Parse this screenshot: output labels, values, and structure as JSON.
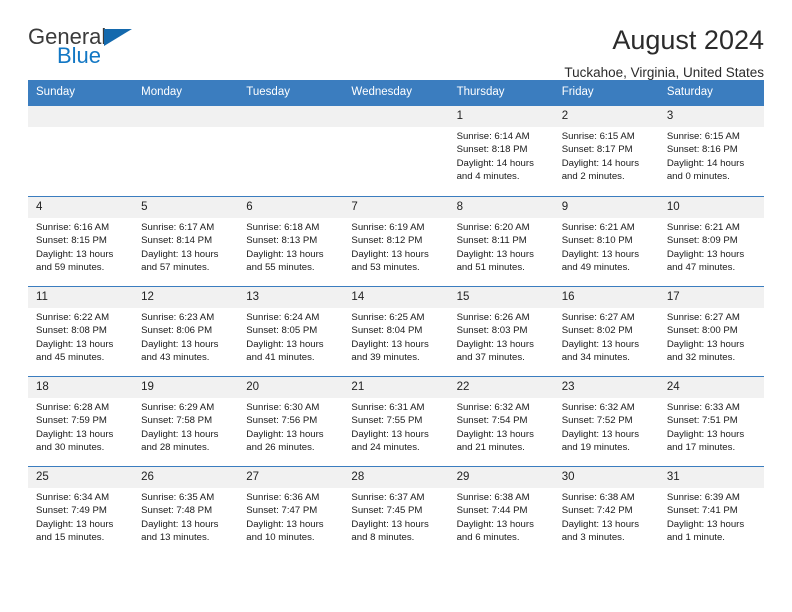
{
  "logo": {
    "line1": "General",
    "line2": "Blue",
    "triangle_icon": "triangle-icon",
    "color_text": "#3b3b3b",
    "color_accent": "#1277c4"
  },
  "header": {
    "title": "August 2024",
    "subtitle": "Tuckahoe, Virginia, United States"
  },
  "theme": {
    "header_blue": "#3b7dbf",
    "daynum_gray": "#f1f1f1"
  },
  "weekdays": [
    "Sunday",
    "Monday",
    "Tuesday",
    "Wednesday",
    "Thursday",
    "Friday",
    "Saturday"
  ],
  "weeks": [
    [
      {
        "day": "",
        "sunrise": "",
        "sunset": "",
        "daylight1": "",
        "daylight2": "",
        "empty": true
      },
      {
        "day": "",
        "sunrise": "",
        "sunset": "",
        "daylight1": "",
        "daylight2": "",
        "empty": true
      },
      {
        "day": "",
        "sunrise": "",
        "sunset": "",
        "daylight1": "",
        "daylight2": "",
        "empty": true
      },
      {
        "day": "",
        "sunrise": "",
        "sunset": "",
        "daylight1": "",
        "daylight2": "",
        "empty": true
      },
      {
        "day": "1",
        "sunrise": "Sunrise: 6:14 AM",
        "sunset": "Sunset: 8:18 PM",
        "daylight1": "Daylight: 14 hours",
        "daylight2": "and 4 minutes."
      },
      {
        "day": "2",
        "sunrise": "Sunrise: 6:15 AM",
        "sunset": "Sunset: 8:17 PM",
        "daylight1": "Daylight: 14 hours",
        "daylight2": "and 2 minutes."
      },
      {
        "day": "3",
        "sunrise": "Sunrise: 6:15 AM",
        "sunset": "Sunset: 8:16 PM",
        "daylight1": "Daylight: 14 hours",
        "daylight2": "and 0 minutes."
      }
    ],
    [
      {
        "day": "4",
        "sunrise": "Sunrise: 6:16 AM",
        "sunset": "Sunset: 8:15 PM",
        "daylight1": "Daylight: 13 hours",
        "daylight2": "and 59 minutes."
      },
      {
        "day": "5",
        "sunrise": "Sunrise: 6:17 AM",
        "sunset": "Sunset: 8:14 PM",
        "daylight1": "Daylight: 13 hours",
        "daylight2": "and 57 minutes."
      },
      {
        "day": "6",
        "sunrise": "Sunrise: 6:18 AM",
        "sunset": "Sunset: 8:13 PM",
        "daylight1": "Daylight: 13 hours",
        "daylight2": "and 55 minutes."
      },
      {
        "day": "7",
        "sunrise": "Sunrise: 6:19 AM",
        "sunset": "Sunset: 8:12 PM",
        "daylight1": "Daylight: 13 hours",
        "daylight2": "and 53 minutes."
      },
      {
        "day": "8",
        "sunrise": "Sunrise: 6:20 AM",
        "sunset": "Sunset: 8:11 PM",
        "daylight1": "Daylight: 13 hours",
        "daylight2": "and 51 minutes."
      },
      {
        "day": "9",
        "sunrise": "Sunrise: 6:21 AM",
        "sunset": "Sunset: 8:10 PM",
        "daylight1": "Daylight: 13 hours",
        "daylight2": "and 49 minutes."
      },
      {
        "day": "10",
        "sunrise": "Sunrise: 6:21 AM",
        "sunset": "Sunset: 8:09 PM",
        "daylight1": "Daylight: 13 hours",
        "daylight2": "and 47 minutes."
      }
    ],
    [
      {
        "day": "11",
        "sunrise": "Sunrise: 6:22 AM",
        "sunset": "Sunset: 8:08 PM",
        "daylight1": "Daylight: 13 hours",
        "daylight2": "and 45 minutes."
      },
      {
        "day": "12",
        "sunrise": "Sunrise: 6:23 AM",
        "sunset": "Sunset: 8:06 PM",
        "daylight1": "Daylight: 13 hours",
        "daylight2": "and 43 minutes."
      },
      {
        "day": "13",
        "sunrise": "Sunrise: 6:24 AM",
        "sunset": "Sunset: 8:05 PM",
        "daylight1": "Daylight: 13 hours",
        "daylight2": "and 41 minutes."
      },
      {
        "day": "14",
        "sunrise": "Sunrise: 6:25 AM",
        "sunset": "Sunset: 8:04 PM",
        "daylight1": "Daylight: 13 hours",
        "daylight2": "and 39 minutes."
      },
      {
        "day": "15",
        "sunrise": "Sunrise: 6:26 AM",
        "sunset": "Sunset: 8:03 PM",
        "daylight1": "Daylight: 13 hours",
        "daylight2": "and 37 minutes."
      },
      {
        "day": "16",
        "sunrise": "Sunrise: 6:27 AM",
        "sunset": "Sunset: 8:02 PM",
        "daylight1": "Daylight: 13 hours",
        "daylight2": "and 34 minutes."
      },
      {
        "day": "17",
        "sunrise": "Sunrise: 6:27 AM",
        "sunset": "Sunset: 8:00 PM",
        "daylight1": "Daylight: 13 hours",
        "daylight2": "and 32 minutes."
      }
    ],
    [
      {
        "day": "18",
        "sunrise": "Sunrise: 6:28 AM",
        "sunset": "Sunset: 7:59 PM",
        "daylight1": "Daylight: 13 hours",
        "daylight2": "and 30 minutes."
      },
      {
        "day": "19",
        "sunrise": "Sunrise: 6:29 AM",
        "sunset": "Sunset: 7:58 PM",
        "daylight1": "Daylight: 13 hours",
        "daylight2": "and 28 minutes."
      },
      {
        "day": "20",
        "sunrise": "Sunrise: 6:30 AM",
        "sunset": "Sunset: 7:56 PM",
        "daylight1": "Daylight: 13 hours",
        "daylight2": "and 26 minutes."
      },
      {
        "day": "21",
        "sunrise": "Sunrise: 6:31 AM",
        "sunset": "Sunset: 7:55 PM",
        "daylight1": "Daylight: 13 hours",
        "daylight2": "and 24 minutes."
      },
      {
        "day": "22",
        "sunrise": "Sunrise: 6:32 AM",
        "sunset": "Sunset: 7:54 PM",
        "daylight1": "Daylight: 13 hours",
        "daylight2": "and 21 minutes."
      },
      {
        "day": "23",
        "sunrise": "Sunrise: 6:32 AM",
        "sunset": "Sunset: 7:52 PM",
        "daylight1": "Daylight: 13 hours",
        "daylight2": "and 19 minutes."
      },
      {
        "day": "24",
        "sunrise": "Sunrise: 6:33 AM",
        "sunset": "Sunset: 7:51 PM",
        "daylight1": "Daylight: 13 hours",
        "daylight2": "and 17 minutes."
      }
    ],
    [
      {
        "day": "25",
        "sunrise": "Sunrise: 6:34 AM",
        "sunset": "Sunset: 7:49 PM",
        "daylight1": "Daylight: 13 hours",
        "daylight2": "and 15 minutes."
      },
      {
        "day": "26",
        "sunrise": "Sunrise: 6:35 AM",
        "sunset": "Sunset: 7:48 PM",
        "daylight1": "Daylight: 13 hours",
        "daylight2": "and 13 minutes."
      },
      {
        "day": "27",
        "sunrise": "Sunrise: 6:36 AM",
        "sunset": "Sunset: 7:47 PM",
        "daylight1": "Daylight: 13 hours",
        "daylight2": "and 10 minutes."
      },
      {
        "day": "28",
        "sunrise": "Sunrise: 6:37 AM",
        "sunset": "Sunset: 7:45 PM",
        "daylight1": "Daylight: 13 hours",
        "daylight2": "and 8 minutes."
      },
      {
        "day": "29",
        "sunrise": "Sunrise: 6:38 AM",
        "sunset": "Sunset: 7:44 PM",
        "daylight1": "Daylight: 13 hours",
        "daylight2": "and 6 minutes."
      },
      {
        "day": "30",
        "sunrise": "Sunrise: 6:38 AM",
        "sunset": "Sunset: 7:42 PM",
        "daylight1": "Daylight: 13 hours",
        "daylight2": "and 3 minutes."
      },
      {
        "day": "31",
        "sunrise": "Sunrise: 6:39 AM",
        "sunset": "Sunset: 7:41 PM",
        "daylight1": "Daylight: 13 hours",
        "daylight2": "and 1 minute."
      }
    ]
  ]
}
